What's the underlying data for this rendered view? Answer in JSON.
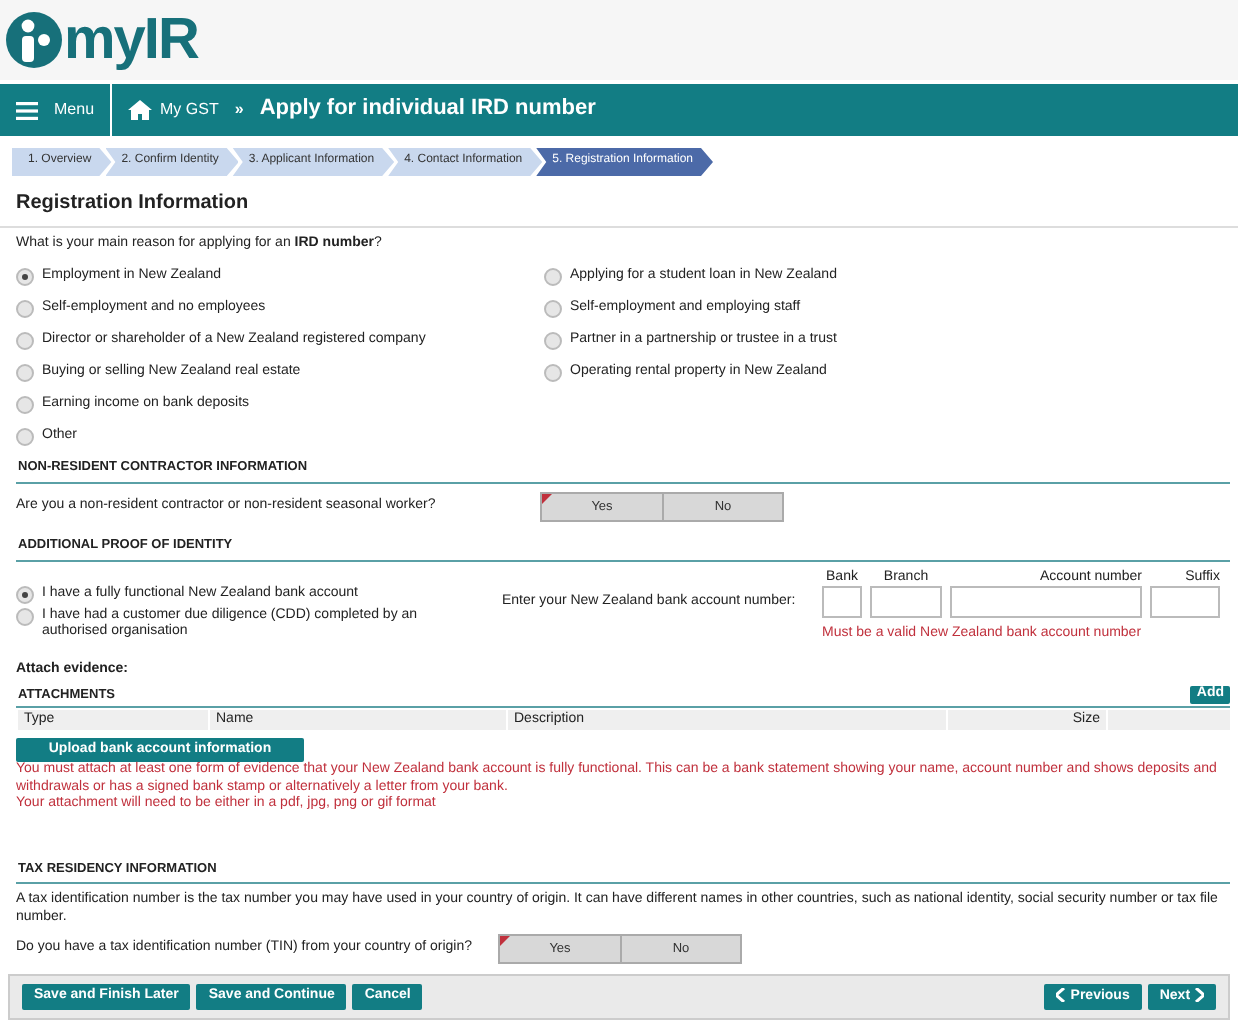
{
  "logo": {
    "text": "myIR"
  },
  "header": {
    "menu": "Menu",
    "breadcrumb": "My GST",
    "separator": "»",
    "title": "Apply for individual IRD number"
  },
  "steps": [
    {
      "label": "1. Overview",
      "selected": false
    },
    {
      "label": "2. Confirm Identity",
      "selected": false
    },
    {
      "label": "3. Applicant Information",
      "selected": false
    },
    {
      "label": "4. Contact Information",
      "selected": false
    },
    {
      "label": "5. Registration Information",
      "selected": true
    }
  ],
  "heading": "Registration Information",
  "reason": {
    "question": "What is your main reason for applying for an **IRD number**?",
    "options_left": [
      {
        "label": "Employment in New Zealand",
        "selected": true
      },
      {
        "label": "Self-employment and no employees",
        "selected": false
      },
      {
        "label": "Director or shareholder of a New Zealand registered company",
        "selected": false
      },
      {
        "label": "Buying or selling New Zealand real estate",
        "selected": false
      },
      {
        "label": "Earning income on bank deposits",
        "selected": false
      },
      {
        "label": "Other",
        "selected": false
      }
    ],
    "options_right": [
      {
        "label": "Applying for a student loan in New Zealand",
        "selected": false
      },
      {
        "label": "Self-employment and employing staff",
        "selected": false
      },
      {
        "label": "Partner in a partnership or trustee in a trust",
        "selected": false
      },
      {
        "label": "Operating rental property in New Zealand",
        "selected": false
      }
    ]
  },
  "non_resident": {
    "title": "NON-RESIDENT CONTRACTOR INFORMATION",
    "question": "Are you a non-resident contractor or non-resident seasonal worker?",
    "toggle": [
      {
        "label": "Yes",
        "selected": false
      },
      {
        "label": "No",
        "selected": false
      }
    ]
  },
  "proof": {
    "title": "ADDITIONAL PROOF OF IDENTITY",
    "options": [
      {
        "label": "I have a fully functional New Zealand bank account",
        "selected": true
      },
      {
        "label": "I have had a customer due diligence (CDD) completed by an authorised organisation",
        "selected": false
      }
    ],
    "bank_prompt": "Enter your New Zealand bank account number:",
    "fields": [
      {
        "label": "Bank"
      },
      {
        "label": "Branch"
      },
      {
        "label": "Account number"
      },
      {
        "label": "Suffix"
      }
    ],
    "error": "Must be a valid New Zealand bank account number"
  },
  "attach_label": "Attach evidence:",
  "attachments": {
    "title": "ATTACHMENTS",
    "add_button": "Add",
    "columns": [
      "Type",
      "Name",
      "Description",
      "Size"
    ],
    "upload_button": "Upload bank account information",
    "notes": [
      "You must attach at least one form of evidence that your New Zealand bank account is fully functional. This can be a bank statement showing your name, account number and shows deposits and withdrawals or has a signed bank stamp or alternatively a letter from your bank.",
      "Your attachment will need to be either in a pdf, jpg, png or gif format"
    ]
  },
  "tax": {
    "title": "TAX RESIDENCY INFORMATION",
    "description": "A tax identification number is the tax number you may have used in your country of origin. It can have different names in other countries, such as national identity, social security number or tax file number.",
    "question": "Do you have a tax identification number (TIN) from your country of origin?",
    "toggle": [
      {
        "label": "Yes",
        "selected": false
      },
      {
        "label": "No",
        "selected": false
      }
    ]
  },
  "footer": {
    "buttons": [
      "Save and Finish Later",
      "Save and Continue",
      "Cancel"
    ],
    "previous": "Previous",
    "next": "Next"
  }
}
